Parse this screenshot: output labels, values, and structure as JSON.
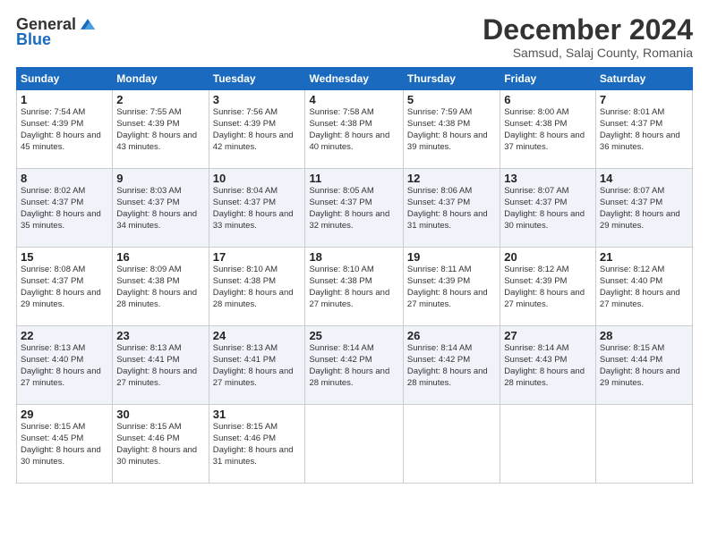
{
  "header": {
    "logo_line1": "General",
    "logo_line2": "Blue",
    "month_title": "December 2024",
    "subtitle": "Samsud, Salaj County, Romania"
  },
  "weekdays": [
    "Sunday",
    "Monday",
    "Tuesday",
    "Wednesday",
    "Thursday",
    "Friday",
    "Saturday"
  ],
  "weeks": [
    [
      {
        "day": "1",
        "sunrise": "Sunrise: 7:54 AM",
        "sunset": "Sunset: 4:39 PM",
        "daylight": "Daylight: 8 hours and 45 minutes."
      },
      {
        "day": "2",
        "sunrise": "Sunrise: 7:55 AM",
        "sunset": "Sunset: 4:39 PM",
        "daylight": "Daylight: 8 hours and 43 minutes."
      },
      {
        "day": "3",
        "sunrise": "Sunrise: 7:56 AM",
        "sunset": "Sunset: 4:39 PM",
        "daylight": "Daylight: 8 hours and 42 minutes."
      },
      {
        "day": "4",
        "sunrise": "Sunrise: 7:58 AM",
        "sunset": "Sunset: 4:38 PM",
        "daylight": "Daylight: 8 hours and 40 minutes."
      },
      {
        "day": "5",
        "sunrise": "Sunrise: 7:59 AM",
        "sunset": "Sunset: 4:38 PM",
        "daylight": "Daylight: 8 hours and 39 minutes."
      },
      {
        "day": "6",
        "sunrise": "Sunrise: 8:00 AM",
        "sunset": "Sunset: 4:38 PM",
        "daylight": "Daylight: 8 hours and 37 minutes."
      },
      {
        "day": "7",
        "sunrise": "Sunrise: 8:01 AM",
        "sunset": "Sunset: 4:37 PM",
        "daylight": "Daylight: 8 hours and 36 minutes."
      }
    ],
    [
      {
        "day": "8",
        "sunrise": "Sunrise: 8:02 AM",
        "sunset": "Sunset: 4:37 PM",
        "daylight": "Daylight: 8 hours and 35 minutes."
      },
      {
        "day": "9",
        "sunrise": "Sunrise: 8:03 AM",
        "sunset": "Sunset: 4:37 PM",
        "daylight": "Daylight: 8 hours and 34 minutes."
      },
      {
        "day": "10",
        "sunrise": "Sunrise: 8:04 AM",
        "sunset": "Sunset: 4:37 PM",
        "daylight": "Daylight: 8 hours and 33 minutes."
      },
      {
        "day": "11",
        "sunrise": "Sunrise: 8:05 AM",
        "sunset": "Sunset: 4:37 PM",
        "daylight": "Daylight: 8 hours and 32 minutes."
      },
      {
        "day": "12",
        "sunrise": "Sunrise: 8:06 AM",
        "sunset": "Sunset: 4:37 PM",
        "daylight": "Daylight: 8 hours and 31 minutes."
      },
      {
        "day": "13",
        "sunrise": "Sunrise: 8:07 AM",
        "sunset": "Sunset: 4:37 PM",
        "daylight": "Daylight: 8 hours and 30 minutes."
      },
      {
        "day": "14",
        "sunrise": "Sunrise: 8:07 AM",
        "sunset": "Sunset: 4:37 PM",
        "daylight": "Daylight: 8 hours and 29 minutes."
      }
    ],
    [
      {
        "day": "15",
        "sunrise": "Sunrise: 8:08 AM",
        "sunset": "Sunset: 4:37 PM",
        "daylight": "Daylight: 8 hours and 29 minutes."
      },
      {
        "day": "16",
        "sunrise": "Sunrise: 8:09 AM",
        "sunset": "Sunset: 4:38 PM",
        "daylight": "Daylight: 8 hours and 28 minutes."
      },
      {
        "day": "17",
        "sunrise": "Sunrise: 8:10 AM",
        "sunset": "Sunset: 4:38 PM",
        "daylight": "Daylight: 8 hours and 28 minutes."
      },
      {
        "day": "18",
        "sunrise": "Sunrise: 8:10 AM",
        "sunset": "Sunset: 4:38 PM",
        "daylight": "Daylight: 8 hours and 27 minutes."
      },
      {
        "day": "19",
        "sunrise": "Sunrise: 8:11 AM",
        "sunset": "Sunset: 4:39 PM",
        "daylight": "Daylight: 8 hours and 27 minutes."
      },
      {
        "day": "20",
        "sunrise": "Sunrise: 8:12 AM",
        "sunset": "Sunset: 4:39 PM",
        "daylight": "Daylight: 8 hours and 27 minutes."
      },
      {
        "day": "21",
        "sunrise": "Sunrise: 8:12 AM",
        "sunset": "Sunset: 4:40 PM",
        "daylight": "Daylight: 8 hours and 27 minutes."
      }
    ],
    [
      {
        "day": "22",
        "sunrise": "Sunrise: 8:13 AM",
        "sunset": "Sunset: 4:40 PM",
        "daylight": "Daylight: 8 hours and 27 minutes."
      },
      {
        "day": "23",
        "sunrise": "Sunrise: 8:13 AM",
        "sunset": "Sunset: 4:41 PM",
        "daylight": "Daylight: 8 hours and 27 minutes."
      },
      {
        "day": "24",
        "sunrise": "Sunrise: 8:13 AM",
        "sunset": "Sunset: 4:41 PM",
        "daylight": "Daylight: 8 hours and 27 minutes."
      },
      {
        "day": "25",
        "sunrise": "Sunrise: 8:14 AM",
        "sunset": "Sunset: 4:42 PM",
        "daylight": "Daylight: 8 hours and 28 minutes."
      },
      {
        "day": "26",
        "sunrise": "Sunrise: 8:14 AM",
        "sunset": "Sunset: 4:42 PM",
        "daylight": "Daylight: 8 hours and 28 minutes."
      },
      {
        "day": "27",
        "sunrise": "Sunrise: 8:14 AM",
        "sunset": "Sunset: 4:43 PM",
        "daylight": "Daylight: 8 hours and 28 minutes."
      },
      {
        "day": "28",
        "sunrise": "Sunrise: 8:15 AM",
        "sunset": "Sunset: 4:44 PM",
        "daylight": "Daylight: 8 hours and 29 minutes."
      }
    ],
    [
      {
        "day": "29",
        "sunrise": "Sunrise: 8:15 AM",
        "sunset": "Sunset: 4:45 PM",
        "daylight": "Daylight: 8 hours and 30 minutes."
      },
      {
        "day": "30",
        "sunrise": "Sunrise: 8:15 AM",
        "sunset": "Sunset: 4:46 PM",
        "daylight": "Daylight: 8 hours and 30 minutes."
      },
      {
        "day": "31",
        "sunrise": "Sunrise: 8:15 AM",
        "sunset": "Sunset: 4:46 PM",
        "daylight": "Daylight: 8 hours and 31 minutes."
      },
      null,
      null,
      null,
      null
    ]
  ]
}
